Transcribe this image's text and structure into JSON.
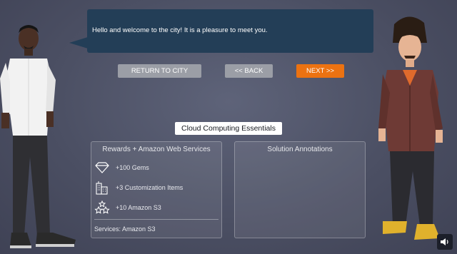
{
  "dialog": {
    "text": "Hello and welcome to the city! It is a pleasure to meet you."
  },
  "buttons": {
    "return": "RETURN TO CITY",
    "back": "<< BACK",
    "next": "NEXT >>"
  },
  "lesson": {
    "title": "Cloud Computing Essentials"
  },
  "rewards_panel": {
    "title": "Rewards + Amazon Web Services",
    "items": [
      {
        "icon": "gem-icon",
        "label": "+100 Gems"
      },
      {
        "icon": "buildings-icon",
        "label": "+3 Customization Items"
      },
      {
        "icon": "stars-icon",
        "label": "+10 Amazon S3"
      }
    ],
    "services": "Services: Amazon S3"
  },
  "annotations_panel": {
    "title": "Solution Annotations"
  },
  "colors": {
    "bubble": "#233e57",
    "accent": "#ec7211",
    "button_gray": "#9b9ea6"
  }
}
